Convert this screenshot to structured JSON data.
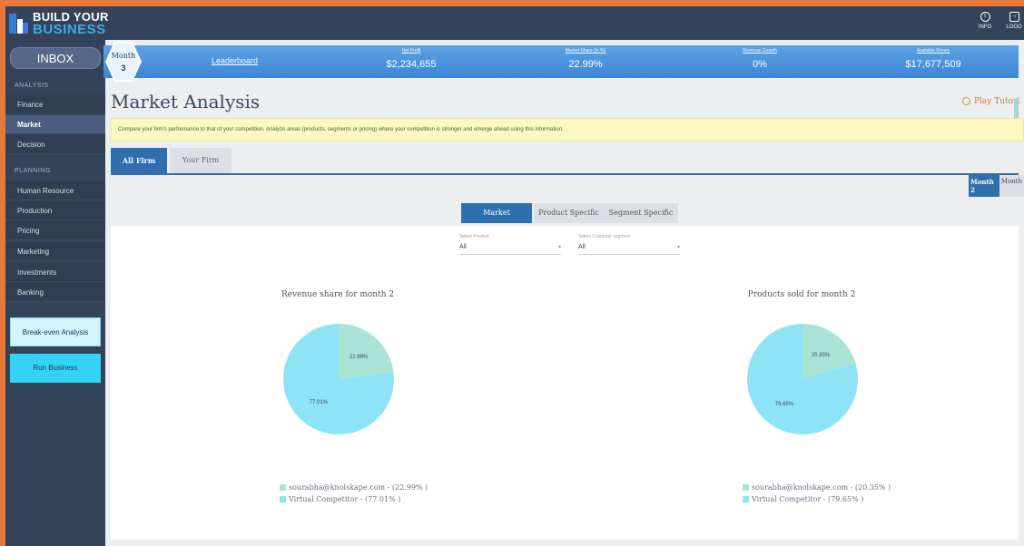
{
  "app": {
    "logo_line1": "BUILD YOUR",
    "logo_line2": "BUSINESS"
  },
  "top_icons": [
    {
      "name": "info-icon",
      "label": "INFO"
    },
    {
      "name": "logout-icon",
      "label": "LOGO"
    }
  ],
  "sidebar": {
    "inbox": "INBOX",
    "section_analysis": "ANALYSIS",
    "analysis_items": [
      "Finance",
      "Market",
      "Decision"
    ],
    "active_item": "Market",
    "section_planning": "PLANNING",
    "planning_items": [
      "Human Resource",
      "Production",
      "Pricing",
      "Marketing",
      "Investments",
      "Banking"
    ],
    "break_even": "Break-even Analysis",
    "run_business": "Run Business"
  },
  "statbar": {
    "month_label": "Month",
    "month_number": "3",
    "leaderboard": "Leaderboard",
    "stats": [
      {
        "key": "Net Profit",
        "value": "$2,234,655"
      },
      {
        "key": "Market Share (in %)",
        "value": "22.99%"
      },
      {
        "key": "Revenue Growth",
        "value": "0%"
      },
      {
        "key": "Available Money",
        "value": "$17,677,509"
      }
    ]
  },
  "page": {
    "title": "Market Analysis",
    "play_tutorial": "Play Tutori",
    "info": "Compare your firm's performance to that of your competition. Analyze areas (products, segments or pricing) where your competition is stronger and emerge ahead using this information."
  },
  "tabs": {
    "all_firm": "All Firm",
    "your_firm": "Your Firm"
  },
  "month_toggle": {
    "selected": "Month 2",
    "other": "Month"
  },
  "subtabs": {
    "market": "Market",
    "product_specific": "Product Specific",
    "segment_specific": "Segment Specific"
  },
  "filters": {
    "product_label": "Select Product",
    "product_value": "All",
    "segment_label": "Select Customer segment",
    "segment_value": "All"
  },
  "colors": {
    "firm": "#a8e3d6",
    "competitor": "#8ee3f7"
  },
  "chart_data": [
    {
      "type": "pie",
      "title": "Revenue share for month 2",
      "labels": [
        "sourabha@knolskape.com - (22.99% )",
        "Virtual Competitor - (77.01% )"
      ],
      "values": [
        22.99,
        77.01
      ],
      "slice_labels": [
        "22.99%",
        "77.01%"
      ],
      "colors": [
        "#a8e3d6",
        "#8ee3f7"
      ]
    },
    {
      "type": "pie",
      "title": "Products sold for month 2",
      "labels": [
        "sourabha@knolskape.com - (20.35% )",
        "Virtual Competitor - (79.65% )"
      ],
      "values": [
        20.35,
        79.65
      ],
      "slice_labels": [
        "20.35%",
        "79.65%"
      ],
      "colors": [
        "#a8e3d6",
        "#8ee3f7"
      ]
    }
  ]
}
